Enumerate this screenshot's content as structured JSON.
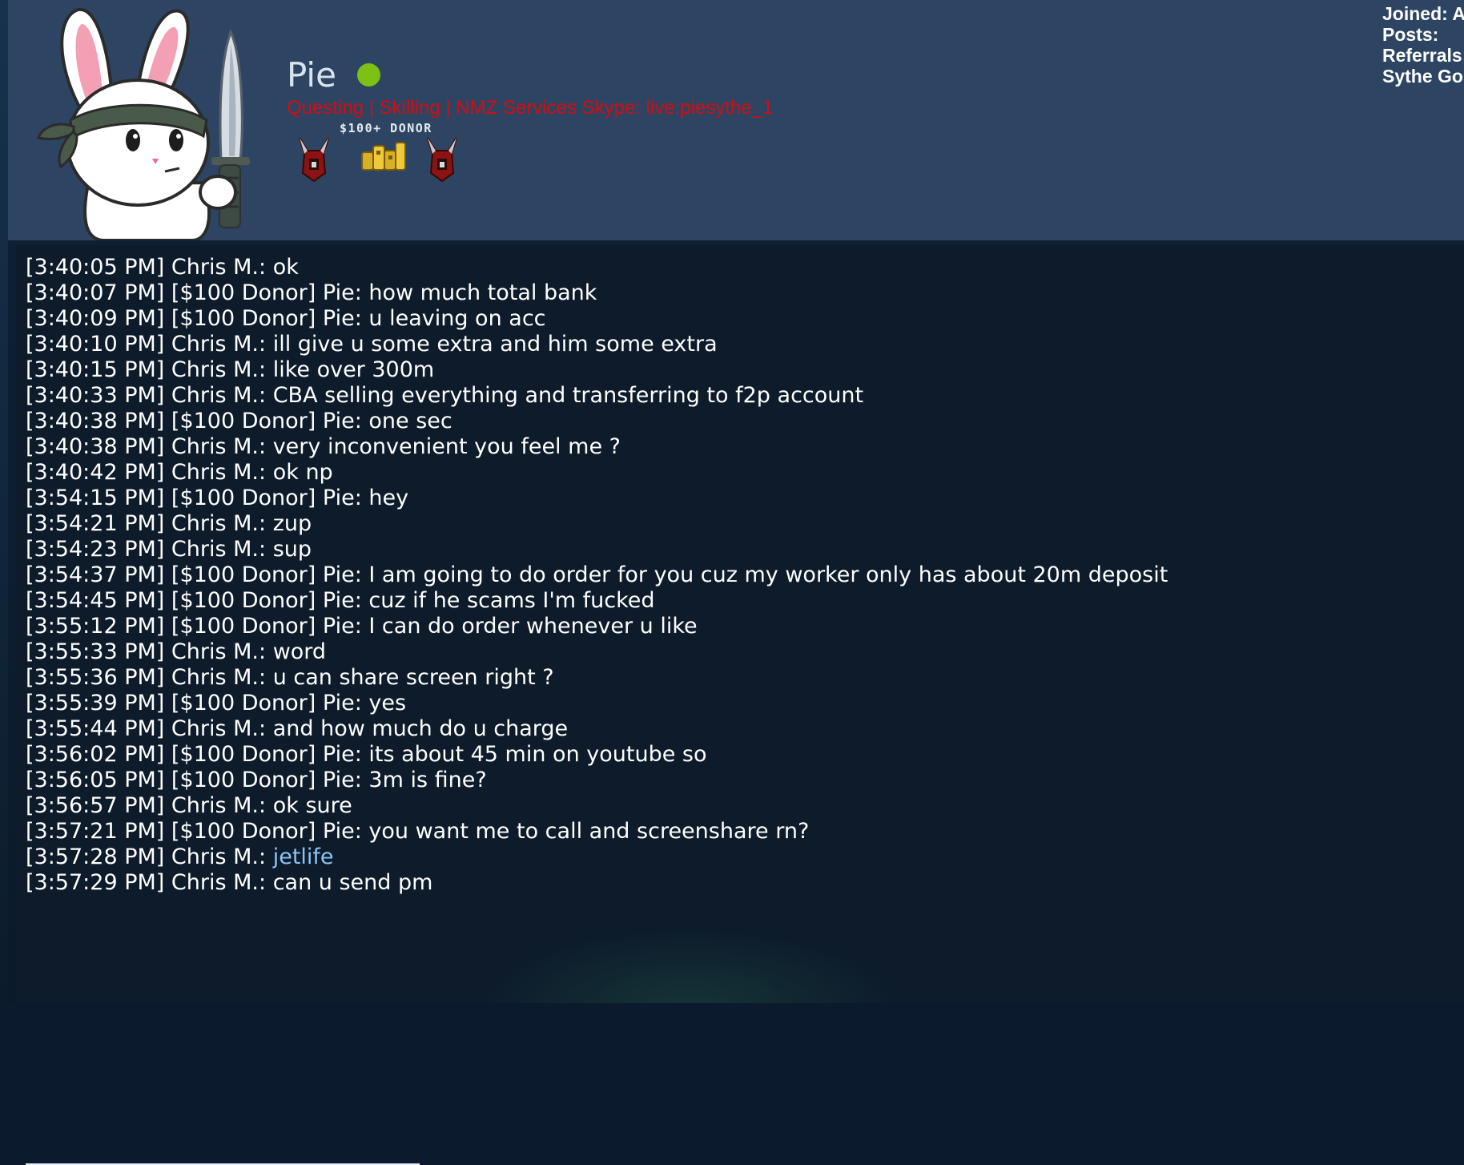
{
  "profile": {
    "username": "Pie",
    "status": "online",
    "user_title": "Questing | Skilling | NMZ Services Skype: live:piesythe_1",
    "badge_label": "$100+ DONOR",
    "badges": [
      "red-helmet-icon",
      "gold-coins-icon",
      "red-helmet-icon"
    ],
    "stats": [
      "Joined: Au",
      "Posts:",
      "Referrals:",
      "Sythe Gol"
    ]
  },
  "chat": {
    "lines": [
      {
        "time": "[3:40:05 PM]",
        "sender": "Chris M.:",
        "message": "ok"
      },
      {
        "time": "[3:40:07 PM]",
        "sender": "[$100 Donor] Pie:",
        "message": "how much total bank"
      },
      {
        "time": "[3:40:09 PM]",
        "sender": "[$100 Donor] Pie:",
        "message": "u leaving on acc"
      },
      {
        "time": "[3:40:10 PM]",
        "sender": "Chris M.:",
        "message": "ill give u some extra and him some extra"
      },
      {
        "time": "[3:40:15 PM]",
        "sender": "Chris M.:",
        "message": "like over 300m"
      },
      {
        "time": "[3:40:33 PM]",
        "sender": "Chris M.:",
        "message": "CBA selling everything and transferring to f2p account"
      },
      {
        "time": "[3:40:38 PM]",
        "sender": "[$100 Donor] Pie:",
        "message": "one sec"
      },
      {
        "time": "[3:40:38 PM]",
        "sender": "Chris M.:",
        "message": "very inconvenient you feel me ?"
      },
      {
        "time": "[3:40:42 PM]",
        "sender": "Chris M.:",
        "message": "ok np"
      },
      {
        "time": "[3:54:15 PM]",
        "sender": "[$100 Donor] Pie:",
        "message": "hey"
      },
      {
        "time": "[3:54:21 PM]",
        "sender": "Chris M.:",
        "message": "zup"
      },
      {
        "time": "[3:54:23 PM]",
        "sender": "Chris M.:",
        "message": "sup"
      },
      {
        "time": "[3:54:37 PM]",
        "sender": "[$100 Donor] Pie:",
        "message": "I am going to do order for you cuz my worker only has about 20m deposit"
      },
      {
        "time": "[3:54:45 PM]",
        "sender": "[$100 Donor] Pie:",
        "message": "cuz if he scams I'm fucked"
      },
      {
        "time": "[3:55:12 PM]",
        "sender": "[$100 Donor] Pie:",
        "message": "I can do order whenever u like"
      },
      {
        "time": "[3:55:33 PM]",
        "sender": "Chris M.:",
        "message": "word"
      },
      {
        "time": "[3:55:36 PM]",
        "sender": "Chris M.:",
        "message": "u can share screen right ?"
      },
      {
        "time": "[3:55:39 PM]",
        "sender": "[$100 Donor] Pie:",
        "message": "yes"
      },
      {
        "time": "[3:55:44 PM]",
        "sender": "Chris M.:",
        "message": "and how much do u charge"
      },
      {
        "time": "[3:56:02 PM]",
        "sender": "[$100 Donor] Pie:",
        "message": "its about 45 min on youtube so"
      },
      {
        "time": "[3:56:05 PM]",
        "sender": "[$100 Donor] Pie:",
        "message": "3m is fine?"
      },
      {
        "time": "[3:56:57 PM]",
        "sender": "Chris M.:",
        "message": "ok sure"
      },
      {
        "time": "[3:57:21 PM]",
        "sender": "[$100 Donor] Pie:",
        "message": "you want me to call and screenshare rn?"
      },
      {
        "time": "[3:57:28 PM]",
        "sender": "Chris M.:",
        "message": "jetlife",
        "is_link": true
      },
      {
        "time": "[3:57:29 PM]",
        "sender": "Chris M.:",
        "message": "can u send pm"
      }
    ]
  },
  "colors": {
    "header_bg": "#2d4562",
    "chat_bg": "#0e1b2b",
    "title_red": "#d40d12",
    "online_green": "#7cc114",
    "link_blue": "#8ec3f6"
  }
}
